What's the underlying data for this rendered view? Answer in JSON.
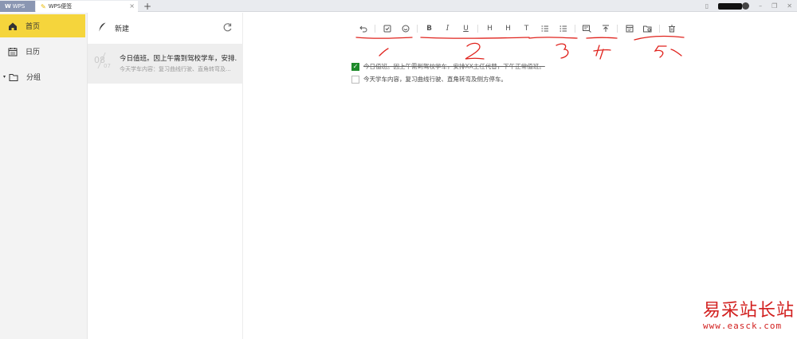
{
  "titlebar": {
    "tab_wps": "WPS",
    "tab_note": "WPS便签",
    "tab_close": "×",
    "tab_add": "+",
    "controls": [
      "minimize-icon",
      "restore-icon",
      "close-icon"
    ]
  },
  "sidebar": {
    "items": [
      {
        "label": "首页",
        "icon": "home-icon",
        "active": true
      },
      {
        "label": "日历",
        "icon": "calendar-icon",
        "active": false
      },
      {
        "label": "分组",
        "icon": "folder-icon",
        "active": false
      }
    ]
  },
  "notelist": {
    "new_label": "新建",
    "note": {
      "day": "08",
      "month": "07",
      "title": "今日值班。因上午需到驾校学车，安排...",
      "preview": "今天学车内容：复习曲线行驶、直角转弯及..."
    }
  },
  "editor": {
    "toolbar": {
      "bold": "B",
      "italic": "I",
      "underline": "U",
      "h1": "H",
      "h2": "H",
      "text": "T"
    },
    "items": [
      {
        "text": "今日值班。因上午需到驾校学车，安排XX主任代替，下午正常值班。",
        "checked": true
      },
      {
        "text": "今天学车内容，复习曲线行驶、直角转弯及侧方停车。",
        "checked": false
      }
    ]
  },
  "watermark": {
    "line1": "易采站长站",
    "line2": "www.easck.com"
  },
  "colors": {
    "accent": "#f5d53c",
    "checkbox": "#1d8a2a",
    "annotation": "#e0231d"
  }
}
